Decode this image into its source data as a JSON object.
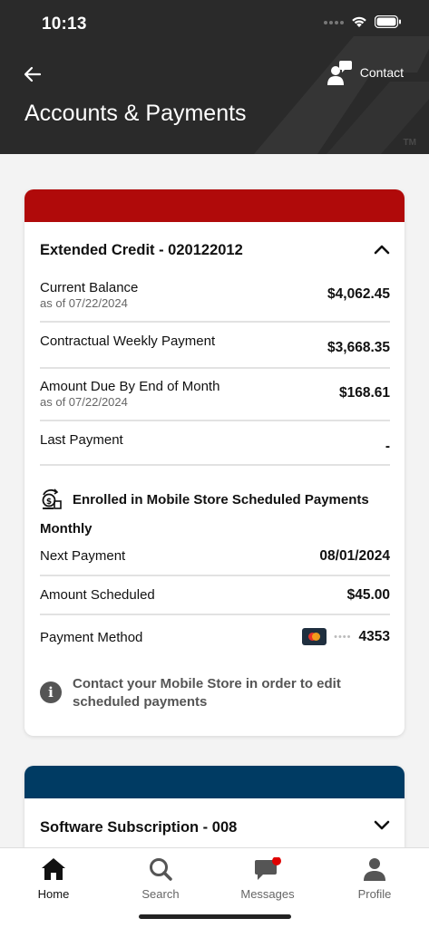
{
  "status_bar": {
    "time": "10:13"
  },
  "header": {
    "title": "Accounts & Payments",
    "contact_label": "Contact",
    "trademark": "TM"
  },
  "extended_credit": {
    "title": "Extended Credit - 020122012",
    "accent_color": "#b00a0a",
    "rows": [
      {
        "label": "Current Balance",
        "sub": "as of 07/22/2024",
        "value": "$4,062.45"
      },
      {
        "label": "Contractual Weekly Payment",
        "sub": "",
        "value": "$3,668.35"
      },
      {
        "label": "Amount Due By End of Month",
        "sub": "as of 07/22/2024",
        "value": "$168.61"
      },
      {
        "label": "Last Payment",
        "sub": "",
        "value": "-"
      }
    ],
    "enrollment": {
      "title": "Enrolled in Mobile Store Scheduled Payments",
      "frequency": "Monthly",
      "next_payment_label": "Next Payment",
      "next_payment_value": "08/01/2024",
      "amount_label": "Amount Scheduled",
      "amount_value": "$45.00",
      "method_label": "Payment Method",
      "card_dots": "••••",
      "card_last4": "4353"
    },
    "info_text": "Contact your Mobile Store in order to edit scheduled payments"
  },
  "software_subscription": {
    "title": "Software Subscription - 008",
    "accent_color": "#003b63"
  },
  "tabs": [
    {
      "label": "Home",
      "icon": "home-icon",
      "active": true
    },
    {
      "label": "Search",
      "icon": "search-icon",
      "active": false
    },
    {
      "label": "Messages",
      "icon": "messages-icon",
      "active": false,
      "badge": true
    },
    {
      "label": "Profile",
      "icon": "profile-icon",
      "active": false
    }
  ]
}
